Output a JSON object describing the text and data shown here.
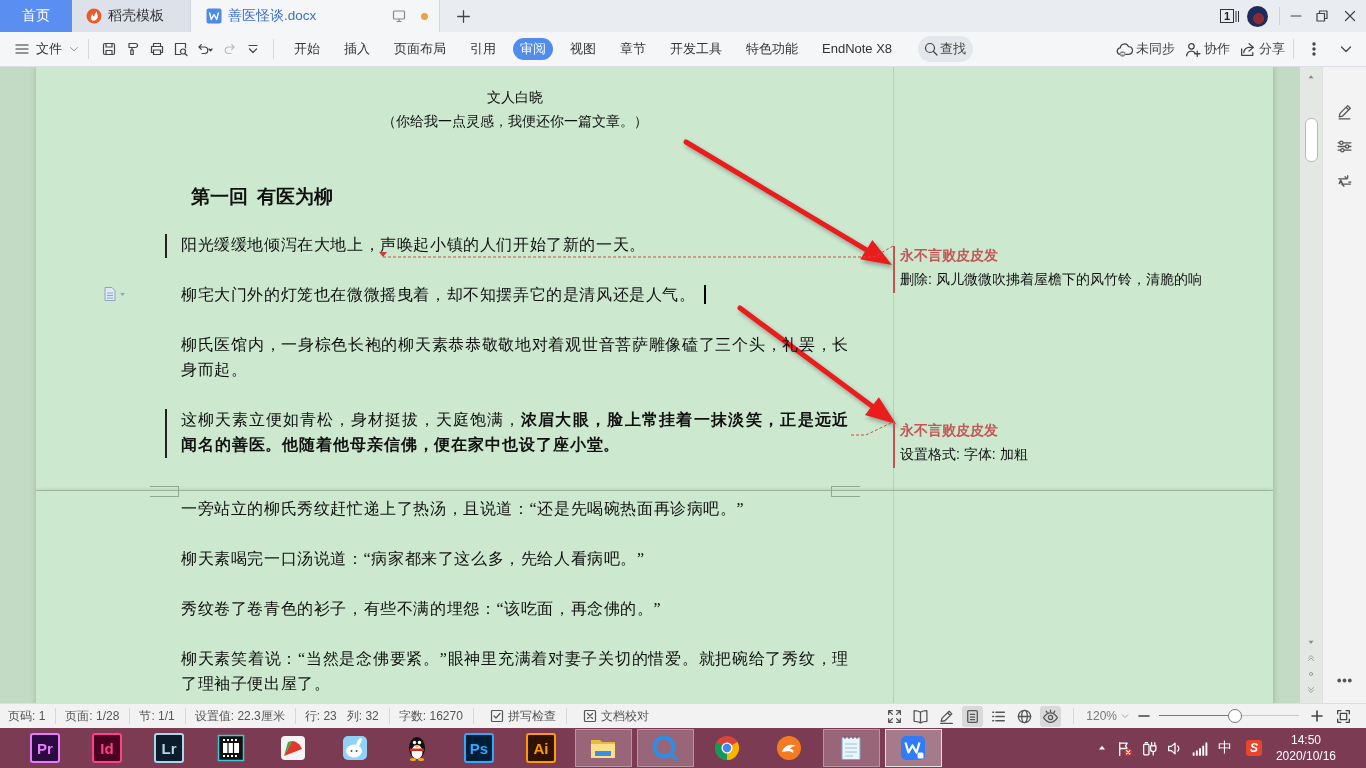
{
  "title_bar": {
    "tabs": [
      {
        "kind": "home",
        "label": "首页",
        "selected": false,
        "unsaved": false
      },
      {
        "kind": "template",
        "label": "稻壳模板",
        "selected": false,
        "unsaved": false
      },
      {
        "kind": "document",
        "label": "善医怪谈.docx",
        "selected": true,
        "unsaved": true
      }
    ],
    "window_count": "1"
  },
  "toolbar": {
    "file_menu": "文件",
    "quick_actions": [
      {
        "kind": "save",
        "disabled": false
      },
      {
        "kind": "format_painter",
        "disabled": false
      },
      {
        "kind": "print",
        "disabled": false
      },
      {
        "kind": "print_preview",
        "disabled": false
      },
      {
        "kind": "undo",
        "disabled": false
      },
      {
        "kind": "redo",
        "disabled": true
      },
      {
        "kind": "customize",
        "disabled": false
      }
    ],
    "ribbon_tabs": [
      {
        "label": "开始",
        "selected": false
      },
      {
        "label": "插入",
        "selected": false
      },
      {
        "label": "页面布局",
        "selected": false
      },
      {
        "label": "引用",
        "selected": false
      },
      {
        "label": "审阅",
        "selected": true
      },
      {
        "label": "视图",
        "selected": false
      },
      {
        "label": "章节",
        "selected": false
      },
      {
        "label": "开发工具",
        "selected": false
      },
      {
        "label": "特色功能",
        "selected": false
      },
      {
        "label": "EndNote X8",
        "selected": false
      }
    ],
    "search": "查找",
    "actions": [
      {
        "kind": "sync",
        "label": "未同步"
      },
      {
        "kind": "collaborate",
        "label": "协作"
      },
      {
        "kind": "share",
        "label": "分享"
      }
    ]
  },
  "document": {
    "pages": [
      {
        "blocks": [
          {
            "kind": "byline",
            "text": "文人白晓",
            "tracked": false,
            "cursor": false
          },
          {
            "kind": "subtitle",
            "text": "（你给我一点灵感，我便还你一篇文章。）",
            "tracked": false,
            "cursor": false
          },
          {
            "kind": "heading",
            "text": "第一回  有医为柳",
            "tracked": false,
            "cursor": false
          },
          {
            "kind": "paragraph",
            "text": "阳光缓缓地倾泻在大地上，声唤起小镇的人们开始了新的一天。",
            "tracked": true,
            "cursor": false,
            "comment": {
              "author": "永不言败皮皮发",
              "text": "删除: 风儿微微吹拂着屋檐下的风竹铃，清脆的响"
            }
          },
          {
            "kind": "paragraph",
            "text": "柳宅大门外的灯笼也在微微摇曳着，却不知摆弄它的是清风还是人气。",
            "tracked": false,
            "cursor": true
          },
          {
            "kind": "paragraph",
            "text": "柳氏医馆内，一身棕色长袍的柳天素恭恭敬敬地对着观世音菩萨雕像磕了三个头，礼罢，长身而起。",
            "tracked": false,
            "cursor": false
          },
          {
            "kind": "paragraph",
            "text": "这柳天素立便如青松，身材挺拔，天庭饱满，**浓眉大眼，脸上常挂着一抹淡笑，正是远近闻名的善医。他随着他母亲信佛，便在家中也设了座小堂。**",
            "tracked": true,
            "cursor": false,
            "comment": {
              "author": "永不言败皮皮发",
              "text": "设置格式: 字体: 加粗"
            }
          }
        ]
      },
      {
        "blocks": [
          {
            "kind": "paragraph",
            "text": "一旁站立的柳氏秀纹赶忙递上了热汤，且说道：“还是先喝碗热面再诊病吧。”",
            "tracked": false,
            "cursor": false
          },
          {
            "kind": "paragraph",
            "text": "柳天素喝完一口汤说道：“病家都来了这么多，先给人看病吧。”",
            "tracked": false,
            "cursor": false
          },
          {
            "kind": "paragraph",
            "text": "秀纹卷了卷青色的衫子，有些不满的埋怨：“该吃面，再念佛的。”",
            "tracked": false,
            "cursor": false
          },
          {
            "kind": "paragraph",
            "text": "柳天素笑着说：“当然是念佛要紧。”眼神里充满着对妻子关切的惜爱。就把碗给了秀纹，理了理袖子便出屋了。",
            "tracked": false,
            "cursor": false
          }
        ]
      }
    ]
  },
  "status_bar": {
    "groups": [
      [
        "页码: 1"
      ],
      [
        "页面: 1/28"
      ],
      [
        "节: 1/1"
      ],
      [
        "设置值: 22.3厘米"
      ],
      [
        "行: 23",
        "列: 32"
      ],
      [
        "字数: 16270"
      ]
    ],
    "checks": [
      {
        "kind": "spell",
        "label": "拼写检查"
      },
      {
        "kind": "proofread",
        "label": "文档校对"
      }
    ],
    "view_modes": [
      {
        "kind": "fullscreen",
        "selected": false
      },
      {
        "kind": "reading",
        "selected": false
      },
      {
        "kind": "edit",
        "selected": false
      },
      {
        "kind": "page",
        "selected": true
      },
      {
        "kind": "outline",
        "selected": false
      },
      {
        "kind": "web",
        "selected": false
      },
      {
        "kind": "eye_care",
        "selected": true
      }
    ],
    "zoom": {
      "label": "120%",
      "level": 0.54
    }
  },
  "taskbar": {
    "apps": [
      {
        "kind": "premiere",
        "label": "Pr",
        "running": false,
        "selected": false
      },
      {
        "kind": "indesign",
        "label": "Id",
        "running": false,
        "selected": false
      },
      {
        "kind": "lightroom",
        "label": "Lr",
        "running": false,
        "selected": false
      },
      {
        "kind": "film",
        "running": false,
        "selected": false
      },
      {
        "kind": "fan",
        "running": false,
        "selected": false
      },
      {
        "kind": "rabbit",
        "running": false,
        "selected": false
      },
      {
        "kind": "penguin",
        "running": false,
        "selected": false
      },
      {
        "kind": "photoshop",
        "label": "Ps",
        "running": false,
        "selected": false
      },
      {
        "kind": "illustrator",
        "label": "Ai",
        "running": false,
        "selected": false
      },
      {
        "kind": "folder",
        "running": true,
        "selected": false
      },
      {
        "kind": "ring",
        "running": true,
        "selected": false
      },
      {
        "kind": "tricolor",
        "running": false,
        "selected": false
      },
      {
        "kind": "orange",
        "running": false,
        "selected": false
      },
      {
        "kind": "notepad",
        "running": true,
        "selected": false
      },
      {
        "kind": "writer",
        "running": true,
        "selected": true
      }
    ],
    "tray": {
      "ime_mode": "中",
      "ime_app": "S",
      "time": "14:50",
      "date": "2020/10/16"
    }
  }
}
